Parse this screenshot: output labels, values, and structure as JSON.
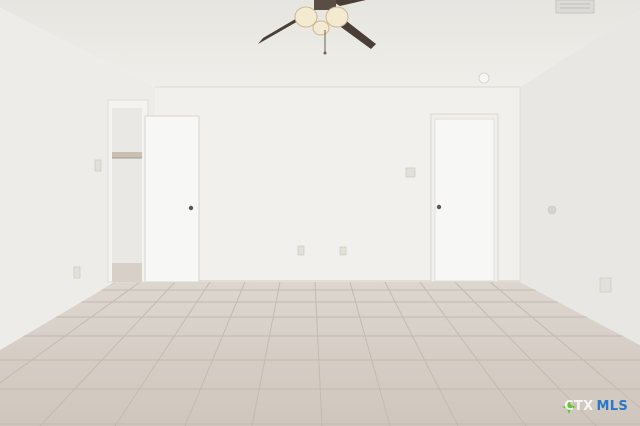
{
  "photo": {
    "subject": "empty-bedroom",
    "colors": {
      "ceiling": "#ecebe6",
      "wall_back": "#f1f0ec",
      "wall_left": "#efeeea",
      "wall_right": "#e9e8e4",
      "door": "#f7f7f5",
      "floor": "#d6cec6",
      "grout": "#c2b9b0",
      "fan_blade": "#4a3f36",
      "fan_light": "#f4ead2"
    }
  },
  "watermark": {
    "part_a": "CTX",
    "part_b": "MLS"
  }
}
